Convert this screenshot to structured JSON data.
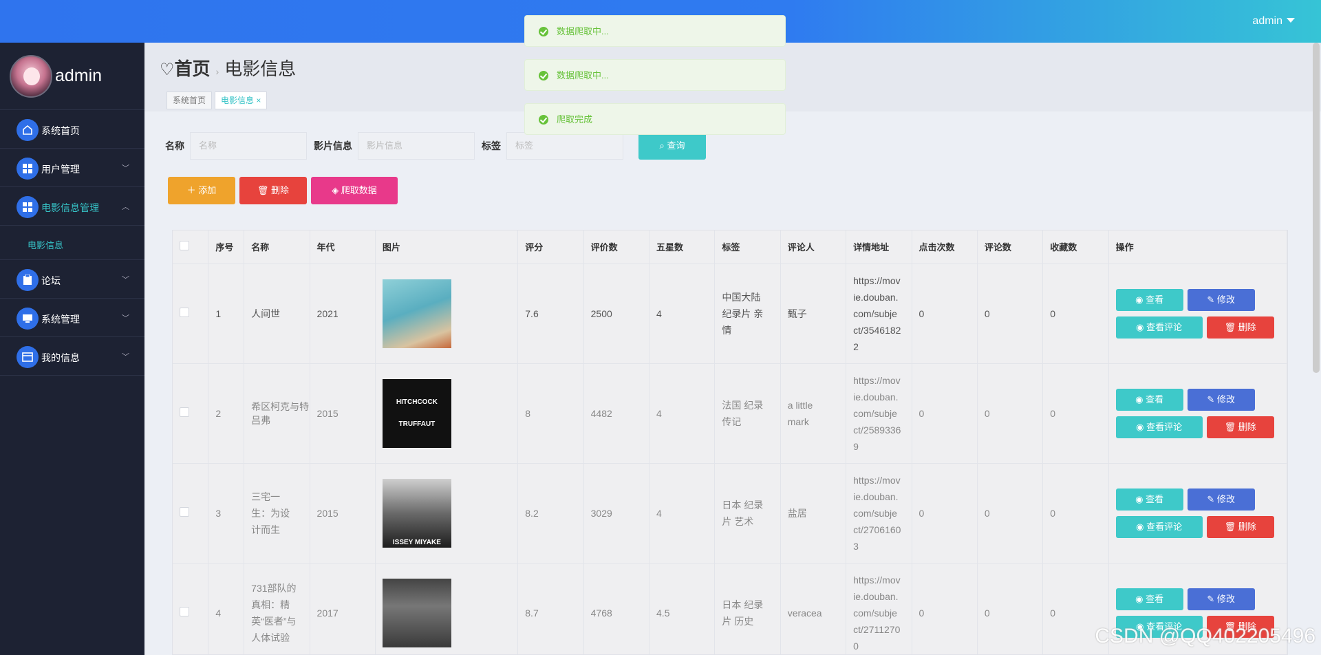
{
  "topbar": {
    "user": "admin"
  },
  "sidebar": {
    "username": "admin",
    "menu": [
      {
        "label": "系统首页",
        "icon": "home-icon"
      },
      {
        "label": "用户管理",
        "icon": "grid-icon"
      },
      {
        "label": "电影信息管理",
        "icon": "grid-icon"
      },
      {
        "label": "论坛",
        "icon": "clipboard-icon"
      },
      {
        "label": "系统管理",
        "icon": "monitor-icon"
      },
      {
        "label": "我的信息",
        "icon": "card-icon"
      }
    ],
    "submenu": "电影信息"
  },
  "breadcrumb": {
    "home": "首页",
    "current": "电影信息"
  },
  "tabs": [
    "系统首页",
    "电影信息 ×"
  ],
  "search": {
    "name_label": "名称",
    "name_placeholder": "名称",
    "info_label": "影片信息",
    "info_placeholder": "影片信息",
    "tag_label": "标签",
    "tag_placeholder": "标签",
    "query_button": "查询"
  },
  "actions": {
    "add": "添加",
    "delete": "删除",
    "crawl": "爬取数据"
  },
  "table": {
    "headers": [
      "序号",
      "名称",
      "年代",
      "图片",
      "评分",
      "评价数",
      "五星数",
      "标签",
      "评论人",
      "详情地址",
      "点击次数",
      "评论数",
      "收藏数",
      "操作"
    ],
    "rows": [
      {
        "no": "1",
        "name": "人间世",
        "year": "2021",
        "score": "7.6",
        "reviews": "2500",
        "five": "4",
        "tag": "中国大陆 纪录片 亲情",
        "reviewer": "甄子",
        "url": "https://movie.douban.com/subject/35461822",
        "clicks": "0",
        "comments": "0",
        "favs": "0"
      },
      {
        "no": "2",
        "name": "希区柯克与特吕弗",
        "year": "2015",
        "score": "8",
        "reviews": "4482",
        "five": "4",
        "tag": "法国 纪录 传记",
        "reviewer": "a little mark",
        "url": "https://movie.douban.com/subject/25893369",
        "clicks": "0",
        "comments": "0",
        "favs": "0"
      },
      {
        "no": "3",
        "name": "三宅一生：为设计而生",
        "year": "2015",
        "score": "8.2",
        "reviews": "3029",
        "five": "4",
        "tag": "日本 纪录 片 艺术",
        "reviewer": "盐居",
        "url": "https://movie.douban.com/subject/27061603",
        "clicks": "0",
        "comments": "0",
        "favs": "0"
      },
      {
        "no": "4",
        "name": "731部队的真相：精英“医者”与人体试验",
        "year": "2017",
        "score": "8.7",
        "reviews": "4768",
        "five": "4.5",
        "tag": "日本 纪录 片 历史",
        "reviewer": "veracea",
        "url": "https://movie.douban.com/subject/27112700",
        "clicks": "0",
        "comments": "0",
        "favs": "0"
      }
    ],
    "op_view": "查看",
    "op_edit": "修改",
    "op_comments": "查看评论",
    "op_delete": "删除"
  },
  "posters": {
    "p2_line1": "HITCHCOCK",
    "p2_line2": "TRUFFAUT",
    "p3": "ISSEY MIYAKE"
  },
  "toasts": [
    "数据爬取中...",
    "数据爬取中...",
    "爬取完成"
  ],
  "watermark": "CSDN @QQ402205496"
}
